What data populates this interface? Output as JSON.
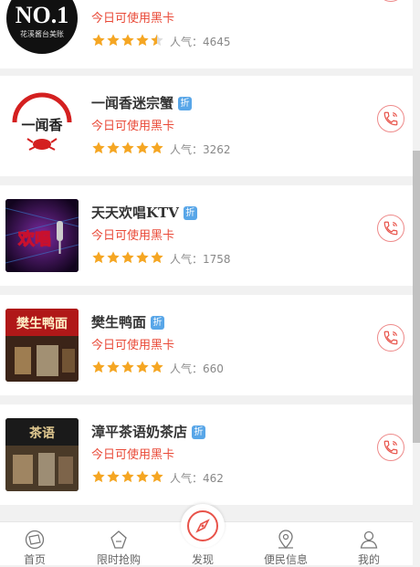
{
  "shops": [
    {
      "name": "",
      "discount": "",
      "promo": "今日可使用黑卡",
      "rating": 4.5,
      "pop_label": "人气：",
      "pop_value": "4645",
      "logo_text": "NO.1",
      "logo_sub": "花溪酱台美账"
    },
    {
      "name": "一闻香迷宗蟹",
      "discount": "折",
      "promo": "今日可使用黑卡",
      "rating": 5,
      "pop_label": "人气：",
      "pop_value": "3262",
      "logo_text": "一闻香"
    },
    {
      "name": "天天欢唱KTV",
      "discount": "折",
      "promo": "今日可使用黑卡",
      "rating": 5,
      "pop_label": "人气：",
      "pop_value": "1758",
      "logo_text": "欢唱"
    },
    {
      "name": "樊生鸭面",
      "discount": "折",
      "promo": "今日可使用黑卡",
      "rating": 5,
      "pop_label": "人气：",
      "pop_value": "660",
      "logo_text": "樊生鸭面"
    },
    {
      "name": "漳平茶语奶茶店",
      "discount": "折",
      "promo": "今日可使用黑卡",
      "rating": 5,
      "pop_label": "人气：",
      "pop_value": "462",
      "logo_text": "茶语"
    }
  ],
  "tabs": [
    {
      "label": "首页",
      "icon": "home-icon"
    },
    {
      "label": "限时抢购",
      "icon": "flash-sale-icon"
    },
    {
      "label": "发现",
      "icon": "compass-icon"
    },
    {
      "label": "便民信息",
      "icon": "location-pin-icon"
    },
    {
      "label": "我的",
      "icon": "user-icon"
    }
  ],
  "colors": {
    "accent": "#e94a38",
    "star": "#f5a623",
    "badge": "#58a6e8"
  }
}
